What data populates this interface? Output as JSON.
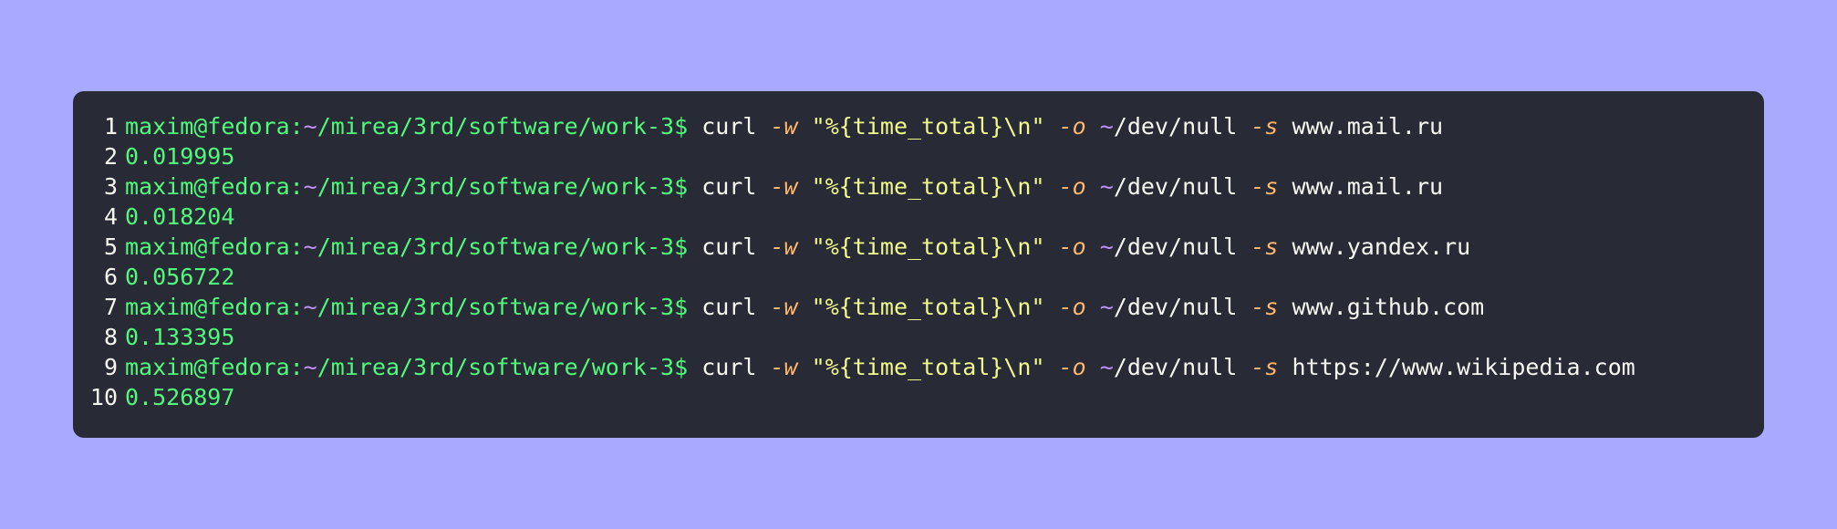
{
  "colors": {
    "background": "#a8abfd",
    "panel": "#282a36",
    "prompt": "#50fa7b",
    "tilde": "#bd93f9",
    "flag": "#ffb86c",
    "string": "#f1fa8c",
    "text": "#f8f8f2"
  },
  "lines": [
    {
      "num": "1",
      "prompt": "maxim@fedora:",
      "tilde": "~",
      "path": "/mirea/3rd/software/work-3$",
      "cmd": "curl",
      "flag_w": "-w",
      "str": "\"%{time_total}\\n\"",
      "flag_o": "-o",
      "tilde2": "~",
      "outpath": "/dev/null",
      "flag_s": "-s",
      "url": "www.mail.ru"
    },
    {
      "num": "2",
      "output": "0.019995"
    },
    {
      "num": "3",
      "prompt": "maxim@fedora:",
      "tilde": "~",
      "path": "/mirea/3rd/software/work-3$",
      "cmd": "curl",
      "flag_w": "-w",
      "str": "\"%{time_total}\\n\"",
      "flag_o": "-o",
      "tilde2": "~",
      "outpath": "/dev/null",
      "flag_s": "-s",
      "url": "www.mail.ru"
    },
    {
      "num": "4",
      "output": "0.018204"
    },
    {
      "num": "5",
      "prompt": "maxim@fedora:",
      "tilde": "~",
      "path": "/mirea/3rd/software/work-3$",
      "cmd": "curl",
      "flag_w": "-w",
      "str": "\"%{time_total}\\n\"",
      "flag_o": "-o",
      "tilde2": "~",
      "outpath": "/dev/null",
      "flag_s": "-s",
      "url": "www.yandex.ru"
    },
    {
      "num": "6",
      "output": "0.056722"
    },
    {
      "num": "7",
      "prompt": "maxim@fedora:",
      "tilde": "~",
      "path": "/mirea/3rd/software/work-3$",
      "cmd": "curl",
      "flag_w": "-w",
      "str": "\"%{time_total}\\n\"",
      "flag_o": "-o",
      "tilde2": "~",
      "outpath": "/dev/null",
      "flag_s": "-s",
      "url": "www.github.com"
    },
    {
      "num": "8",
      "output": "0.133395"
    },
    {
      "num": "9",
      "prompt": "maxim@fedora:",
      "tilde": "~",
      "path": "/mirea/3rd/software/work-3$",
      "cmd": "curl",
      "flag_w": "-w",
      "str": "\"%{time_total}\\n\"",
      "flag_o": "-o",
      "tilde2": "~",
      "outpath": "/dev/null",
      "flag_s": "-s",
      "url": "https://www.wikipedia.com"
    },
    {
      "num": "10",
      "output": "0.526897"
    }
  ]
}
